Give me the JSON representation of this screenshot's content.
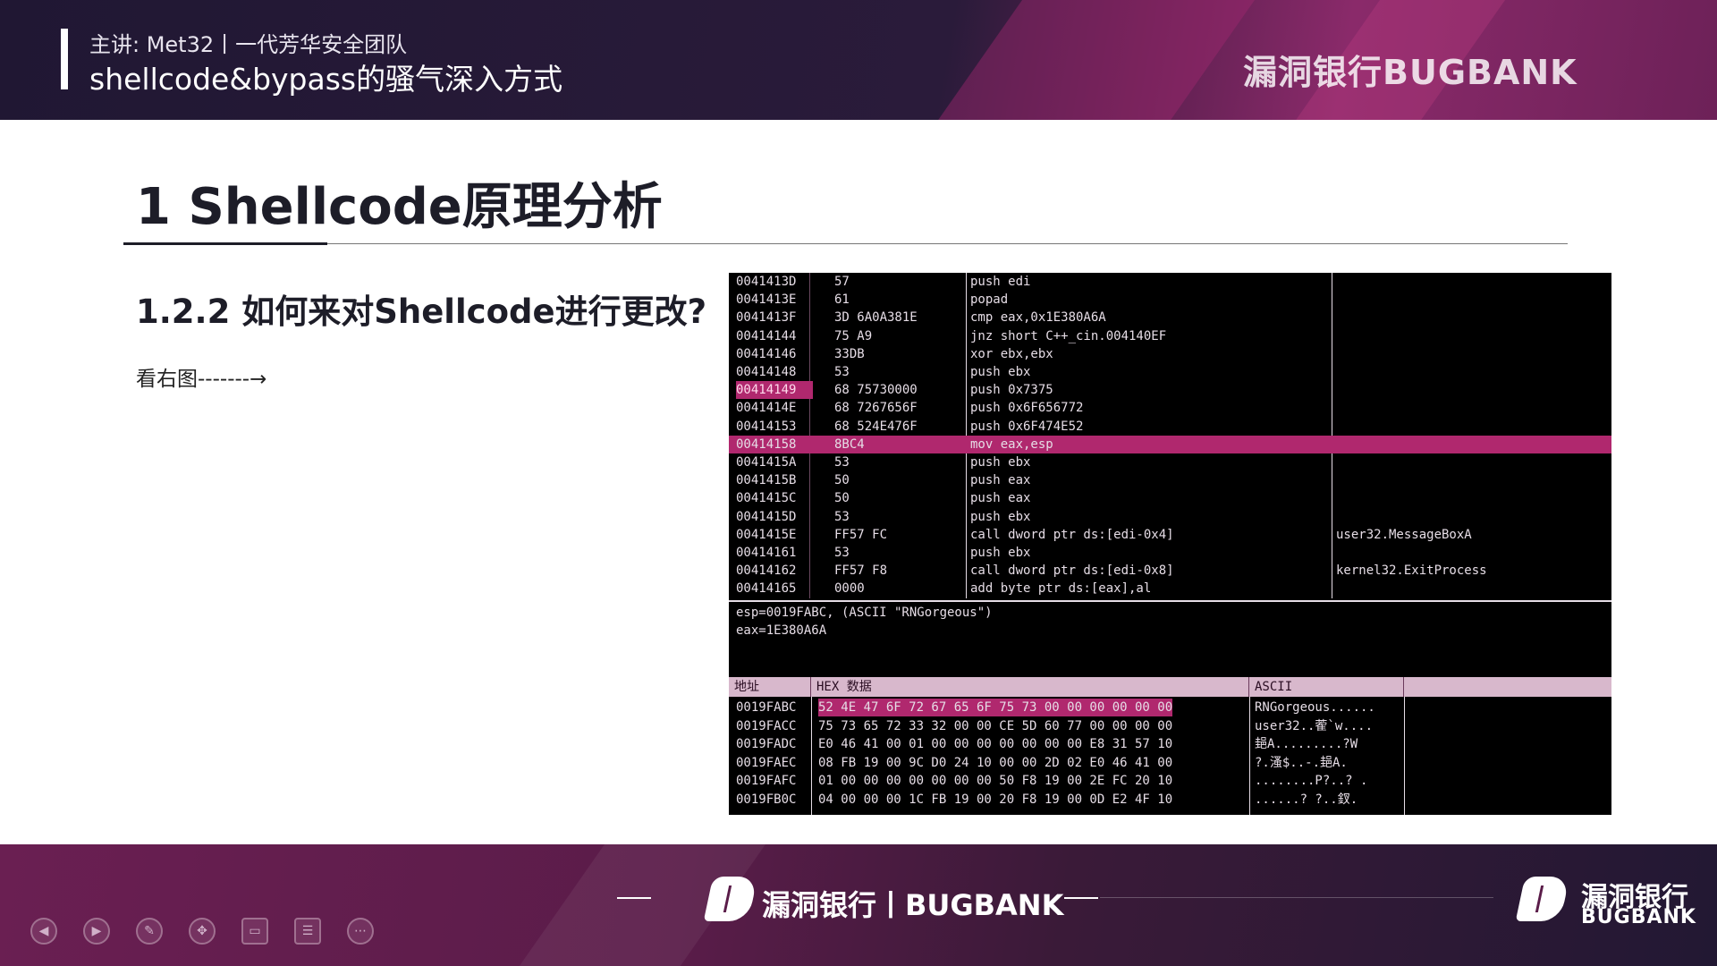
{
  "header": {
    "speaker": "主讲:  Met32丨一代芳华安全团队",
    "course_title": "shellcode&bypass的骚气深入方式",
    "brand": "漏洞银行BUGBANK"
  },
  "slide": {
    "title": "1 Shellcode原理分析",
    "subtitle": "1.2.2 如何来对Shellcode进行更改?",
    "see_right": "看右图-------→"
  },
  "debugger": {
    "disasm_rows": [
      {
        "addr": "0041413D",
        "hex": "57",
        "asm": "push edi",
        "comment": ""
      },
      {
        "addr": "0041413E",
        "hex": "61",
        "asm": "popad",
        "comment": ""
      },
      {
        "addr": "0041413F",
        "hex": "3D 6A0A381E",
        "asm": "cmp eax,0x1E380A6A",
        "comment": ""
      },
      {
        "addr": "00414144",
        "hex": "75 A9",
        "asm": "jnz short C++_cin.004140EF",
        "comment": ""
      },
      {
        "addr": "00414146",
        "hex": "33DB",
        "asm": "xor ebx,ebx",
        "comment": ""
      },
      {
        "addr": "00414148",
        "hex": "53",
        "asm": "push ebx",
        "comment": ""
      },
      {
        "addr": "00414149",
        "hex": "68 75730000",
        "asm": "push 0x7375",
        "comment": ""
      },
      {
        "addr": "0041414E",
        "hex": "68 7267656F",
        "asm": "push 0x6F656772",
        "comment": ""
      },
      {
        "addr": "00414153",
        "hex": "68 524E476F",
        "asm": "push 0x6F474E52",
        "comment": ""
      },
      {
        "addr": "00414158",
        "hex": "8BC4",
        "asm": "mov eax,esp",
        "comment": ""
      },
      {
        "addr": "0041415A",
        "hex": "53",
        "asm": "push ebx",
        "comment": ""
      },
      {
        "addr": "0041415B",
        "hex": "50",
        "asm": "push eax",
        "comment": ""
      },
      {
        "addr": "0041415C",
        "hex": "50",
        "asm": "push eax",
        "comment": ""
      },
      {
        "addr": "0041415D",
        "hex": "53",
        "asm": "push ebx",
        "comment": ""
      },
      {
        "addr": "0041415E",
        "hex": "FF57 FC",
        "asm": "call dword ptr ds:[edi-0x4]",
        "comment": "user32.MessageBoxA"
      },
      {
        "addr": "00414161",
        "hex": "53",
        "asm": "push ebx",
        "comment": ""
      },
      {
        "addr": "00414162",
        "hex": "FF57 F8",
        "asm": "call dword ptr ds:[edi-0x8]",
        "comment": "kernel32.ExitProcess"
      },
      {
        "addr": "00414165",
        "hex": "0000",
        "asm": "add byte ptr ds:[eax],al",
        "comment": ""
      }
    ],
    "info_lines": [
      "esp=0019FABC, (ASCII \"RNGorgeous\")",
      "eax=1E380A6A"
    ],
    "dump_headers": {
      "addr": "地址",
      "hex": "HEX 数据",
      "ascii": "ASCII"
    },
    "dump_rows": [
      {
        "addr": "0019FABC",
        "hex": "52 4E 47 6F 72 67 65 6F 75 73 00 00 00 00 00 00",
        "ascii": "RNGorgeous......"
      },
      {
        "addr": "0019FACC",
        "hex": "75 73 65 72 33 32 00 00 CE 5D 60 77 00 00 00 00",
        "ascii": "user32..蒮`w...."
      },
      {
        "addr": "0019FADC",
        "hex": "E0 46 41 00 01 00 00 00 00 00 00 00 E8 31 57 10",
        "ascii": "郌A.........?W"
      },
      {
        "addr": "0019FAEC",
        "hex": "08 FB 19 00 9C D0 24 10 00 00 2D 02 E0 46 41 00",
        "ascii": "?.溞$..-.郌A."
      },
      {
        "addr": "0019FAFC",
        "hex": "01 00 00 00 00 00 00 00 50 F8 19 00 2E FC 20 10",
        "ascii": "........P?..? ."
      },
      {
        "addr": "0019FB0C",
        "hex": "04 00 00 00 1C FB 19 00 20 F8 19 00 0D E2 4F 10",
        "ascii": "......? ?..釵."
      }
    ]
  },
  "footer": {
    "brand_center": "漏洞银行丨BUGBANK",
    "brand_corner_cn": "漏洞银行",
    "brand_corner_en": "BUGBANK",
    "controls": [
      "prev-icon",
      "next-icon",
      "pen-icon",
      "pointer-icon",
      "camera-icon",
      "notes-icon",
      "more-icon"
    ]
  },
  "colors": {
    "accent": "#b0286e",
    "header_bg": "#201733",
    "footer_bg": "#5a1c49"
  }
}
